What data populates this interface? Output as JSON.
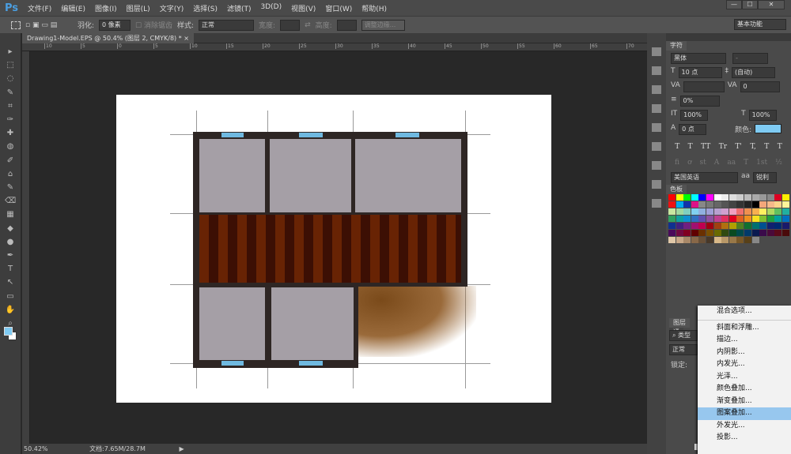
{
  "app": {
    "logo": "Ps",
    "menus": [
      "文件(F)",
      "编辑(E)",
      "图像(I)",
      "图层(L)",
      "文字(Y)",
      "选择(S)",
      "滤镜(T)",
      "3D(D)",
      "视图(V)",
      "窗口(W)",
      "帮助(H)"
    ],
    "window_buttons": [
      "—",
      "☐",
      "✕"
    ]
  },
  "options": {
    "feather_label": "羽化:",
    "feather_value": "0 像素",
    "antialias": "消除锯齿",
    "style_label": "样式:",
    "style_value": "正常",
    "width_label": "宽度:",
    "height_label": "高度:",
    "refine_edge": "调整边缘...",
    "workspace": "基本功能"
  },
  "document": {
    "tab": "Drawing1-Model.EPS @ 50.4% (图层 2, CMYK/8) *",
    "close": "×",
    "zoom": "50.42%",
    "doc_size": "文档:7.65M/28.7M"
  },
  "character": {
    "tab": "字符",
    "font": "黑体",
    "style": "-",
    "size": "10 点",
    "leading": "(自动)",
    "kerning": "",
    "tracking": "0",
    "tsume": "0%",
    "vscale": "100%",
    "hscale": "100%",
    "baseline": "0 点",
    "color_label": "颜色:",
    "color": "#7fcbf3",
    "language": "美国英语",
    "aa_label": "aa",
    "aa": "锐利",
    "type_styles": [
      "T",
      "T",
      "TT",
      "Tr",
      "T'",
      "T,",
      "T",
      "T"
    ],
    "ot_styles": [
      "fi",
      "ơ",
      "st",
      "A",
      "aa",
      "T",
      "1st",
      "½"
    ]
  },
  "swatches": {
    "tab": "色板",
    "colors": [
      "#ff0000",
      "#ffff00",
      "#00ff00",
      "#00ffff",
      "#0000ff",
      "#ff00ff",
      "#ffffff",
      "#eeeeee",
      "#dddddd",
      "#cccccc",
      "#bbbbbb",
      "#aaaaaa",
      "#999999",
      "#888888",
      "#dd0022",
      "#ffee00",
      "#ee1111",
      "#00aaee",
      "#1133aa",
      "#dd1188",
      "#888888",
      "#777777",
      "#666666",
      "#555555",
      "#444444",
      "#333333",
      "#222222",
      "#000000",
      "#f4a77a",
      "#f6b98a",
      "#fdd48a",
      "#fff59a",
      "#c8e6a0",
      "#a0d8a0",
      "#80cfc0",
      "#80d0f0",
      "#90b0e0",
      "#a0a0d8",
      "#b8a0d0",
      "#d0a0d0",
      "#f0a0c0",
      "#f07070",
      "#f09050",
      "#f8b050",
      "#fff060",
      "#b0d860",
      "#60c060",
      "#20b0a0",
      "#30a060",
      "#10a0a0",
      "#1090d0",
      "#3070c0",
      "#6050b0",
      "#9050a0",
      "#c04090",
      "#e03060",
      "#e00020",
      "#e06020",
      "#f09020",
      "#f8e020",
      "#80c030",
      "#20a040",
      "#00a0a0",
      "#0070c0",
      "#103090",
      "#402080",
      "#702080",
      "#a01070",
      "#c00050",
      "#a00010",
      "#a04010",
      "#b07010",
      "#b0a000",
      "#508020",
      "#107030",
      "#007070",
      "#005090",
      "#102070",
      "#002870",
      "#1a1a6a",
      "#4a0a5a",
      "#700a40",
      "#800020",
      "#600000",
      "#6a3000",
      "#7a5000",
      "#6a6a00",
      "#304a10",
      "#0a4a20",
      "#004a4a",
      "#003a6a",
      "#0a1a50",
      "#3a0a4a",
      "#4a0a3a",
      "#5a0a1a",
      "#4a0a0a",
      "#e0c8a8",
      "#c8a888",
      "#a88868",
      "#886848",
      "#685038",
      "#483828",
      "#d8b888",
      "#b89868",
      "#987848",
      "#785828",
      "#584018",
      "#888888"
    ]
  },
  "layers": {
    "tab": "图层",
    "tab2": "通",
    "filter": "类型",
    "blend": "正常",
    "lock": "锁定:",
    "fx": "fx"
  },
  "context_menu": {
    "items": [
      "混合选项...",
      "斜面和浮雕...",
      "描边...",
      "内阴影...",
      "内发光...",
      "光泽...",
      "颜色叠加...",
      "渐变叠加...",
      "图案叠加...",
      "外发光...",
      "投影..."
    ],
    "highlighted": 8
  },
  "ruler": {
    "top": [
      "10",
      "5",
      "0",
      "5",
      "10",
      "15",
      "20",
      "25",
      "30",
      "35",
      "40",
      "45",
      "50",
      "55",
      "60",
      "65",
      "70"
    ]
  }
}
